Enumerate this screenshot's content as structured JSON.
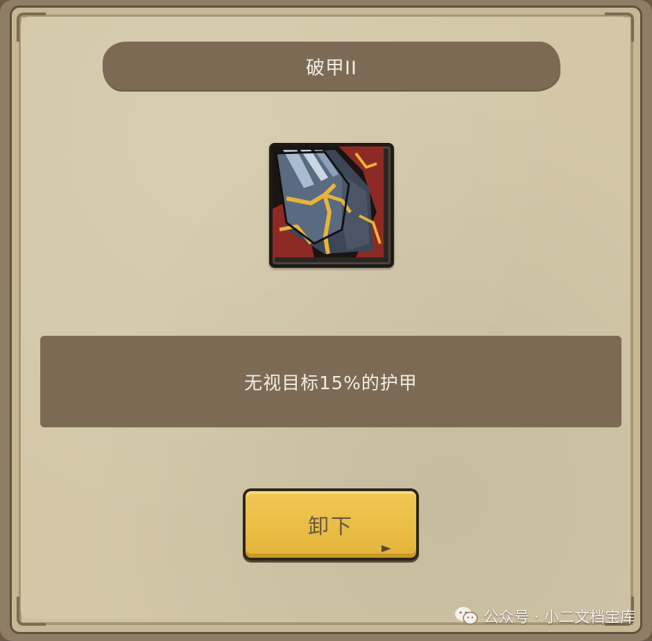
{
  "dialog": {
    "title": "破甲II",
    "icon": "armor-break-icon",
    "description": "无视目标15%的护甲",
    "button_label": "卸下"
  },
  "watermark": {
    "text": "公众号 · 小二文档宝库",
    "icon": "wechat-icon"
  },
  "colors": {
    "panel": "#d3c7a8",
    "banner": "#7d6a55",
    "button": "#e8bc45",
    "text_light": "#f2eee4"
  }
}
